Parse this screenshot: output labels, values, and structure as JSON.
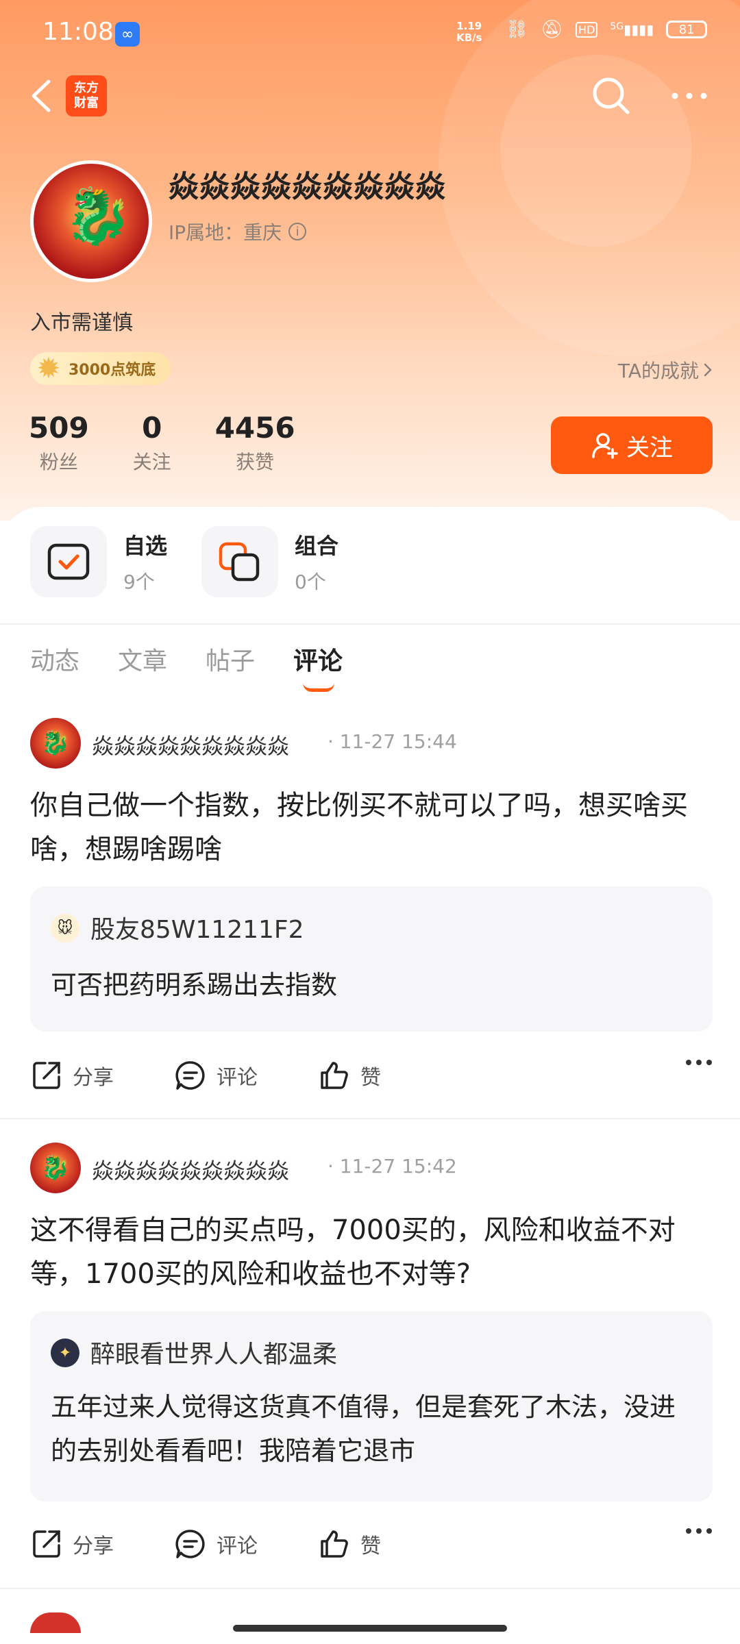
{
  "status_bar": {
    "time": "11:08",
    "net_speed_value": "1.19",
    "net_speed_unit": "KB/s",
    "network": "5G",
    "hd": "HD",
    "battery": "81"
  },
  "nav": {
    "logo_line1": "东方",
    "logo_line2": "财富"
  },
  "profile": {
    "username": "焱焱焱焱焱焱焱焱焱",
    "ip_label": "IP属地：重庆",
    "bio": "入市需谨慎",
    "medal": "3000点筑底",
    "achievements_link": "TA的成就",
    "stats": [
      {
        "value": "509",
        "label": "粉丝"
      },
      {
        "value": "0",
        "label": "关注"
      },
      {
        "value": "4456",
        "label": "获赞"
      }
    ],
    "follow_label": "关注"
  },
  "quick_links": [
    {
      "title": "自选",
      "sub": "9个"
    },
    {
      "title": "组合",
      "sub": "0个"
    }
  ],
  "tabs": [
    "动态",
    "文章",
    "帖子",
    "评论"
  ],
  "posts": [
    {
      "author": "焱焱焱焱焱焱焱焱焱",
      "time": "· 11-27 15:44",
      "text": "你自己做一个指数，按比例买不就可以了吗，想买啥买啥，想踢啥踢啥",
      "quote_author": "股友85W11211F2",
      "quote_text": "可否把药明系踢出去指数"
    },
    {
      "author": "焱焱焱焱焱焱焱焱焱",
      "time": "· 11-27 15:42",
      "text": "这不得看自己的买点吗，7000买的，风险和收益不对等，1700买的风险和收益也不对等?",
      "quote_author": "醉眼看世界人人都温柔",
      "quote_text": "五年过来人觉得这货真不值得，但是套死了木法，没进的去别处看看吧！我陪着它退市"
    }
  ],
  "actions": {
    "share": "分享",
    "comment": "评论",
    "like": "赞"
  },
  "colors": {
    "accent": "#ff5a0f",
    "header_top": "#ff9a62"
  }
}
